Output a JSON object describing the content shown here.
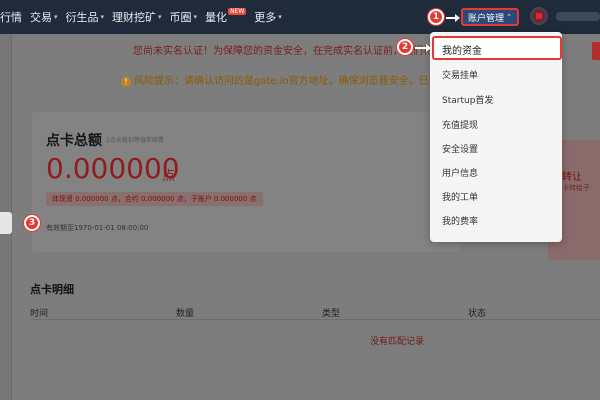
{
  "nav": {
    "items": [
      {
        "label": "行情",
        "chev": false
      },
      {
        "label": "交易",
        "chev": true
      },
      {
        "label": "衍生品",
        "chev": true
      },
      {
        "label": "理财挖矿",
        "chev": true
      },
      {
        "label": "币圈",
        "chev": true
      },
      {
        "label": "量化",
        "chev": false,
        "badge": "NEW"
      },
      {
        "label": "更多",
        "chev": true
      }
    ],
    "account_button": "账户管理",
    "chev_glyph": "⌃"
  },
  "banners": {
    "realname": "您尚未实名认证！为保障您的资金安全，在完成实名认证前，我们将限制您部分操作。",
    "risk": "风险提示：请确认访问的是gate.io官方地址，确保浏览器安全，已开启两步验证"
  },
  "dropdown": {
    "items": [
      "我的资金",
      "交易挂单",
      "Startup首发",
      "充值提现",
      "安全设置",
      "用户信息",
      "我的工单",
      "我的费率"
    ]
  },
  "card": {
    "title": "点卡总额",
    "subtitle": "1点卡抵扣等值手续费",
    "amount": "0.000000",
    "unit": "点",
    "breakdown": "体现贤 0.000000 点，合约 0.000000 点，子账户 0.000000 点",
    "valid_until": "有效期至1970-01-01 08:00:00"
  },
  "side_card": {
    "title": "转让",
    "subtitle": "点卡转给子"
  },
  "detail": {
    "title": "点卡明细",
    "columns": [
      "时间",
      "数量",
      "类型",
      "状态"
    ],
    "empty_text": "没有匹配记录"
  },
  "steps": [
    "1",
    "2",
    "3"
  ]
}
